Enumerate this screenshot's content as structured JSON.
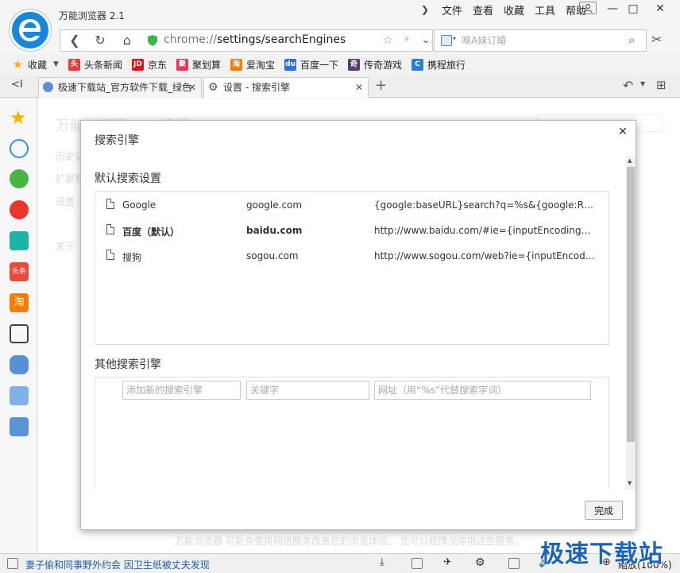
{
  "window": {
    "app_title": "万能浏览器 2.1",
    "menu": [
      "文件",
      "查看",
      "收藏",
      "工具",
      "帮助"
    ]
  },
  "address": {
    "scheme": "chrome://",
    "path": "settings/searchEngines",
    "search_placeholder": "嗅A妹订婚"
  },
  "bookmarks": [
    {
      "label": "收藏",
      "icon": "star-icon",
      "color": "#f5b400"
    },
    {
      "label": "头条新闻",
      "icon": "toutiao-icon",
      "color": "#e63b3b"
    },
    {
      "label": "京东",
      "icon": "jd-icon",
      "color": "#d7141a"
    },
    {
      "label": "聚划算",
      "icon": "juhuasuan-icon",
      "color": "#e6345a"
    },
    {
      "label": "爱淘宝",
      "icon": "aitaobao-icon",
      "color": "#ff7a00"
    },
    {
      "label": "百度一下",
      "icon": "baidu-paw-icon",
      "color": "#2f6fdc"
    },
    {
      "label": "传奇游戏",
      "icon": "game-avatar-icon",
      "color": "#5a3b6e"
    },
    {
      "label": "携程旅行",
      "icon": "ctrip-icon",
      "color": "#2a7fd4"
    }
  ],
  "tabs": [
    {
      "label": "极速下载站_官方软件下载_绿色",
      "icon": "globe-icon"
    },
    {
      "label": "设置 - 搜索引擎",
      "icon": "gear-icon"
    }
  ],
  "background_page": {
    "title": "万能浏览器",
    "subtitle": "设置",
    "nav": [
      "历史记",
      "扩展程",
      "设置",
      "关于"
    ],
    "footer": "万能浏览器 可能会使用网络服务改善您的浏览体验。 您可以视情况停用这些服务。"
  },
  "dialog": {
    "title": "搜索引擎",
    "default_section": "默认搜索设置",
    "default_engines": [
      {
        "name": "Google",
        "keyword": "google.com",
        "url": "{google:baseURL}search?q=%s&{google:RLZ}{goo…",
        "is_default": false
      },
      {
        "name": "百度（默认）",
        "keyword": "baidu.com",
        "url": "http://www.baidu.com/#ie={inputEncoding}&wd=…",
        "is_default": true
      },
      {
        "name": "搜狗",
        "keyword": "sogou.com",
        "url": "http://www.sogou.com/web?ie={inputEncoding}&…",
        "is_default": false
      }
    ],
    "other_section": "其他搜索引擎",
    "add_name_placeholder": "添加新的搜索引擎",
    "add_keyword_placeholder": "关键字",
    "add_url_placeholder": "网址（用“%s”代替搜索字词）",
    "done_label": "完成"
  },
  "status": {
    "news": "妻子偷和同事野外约会 因卫生纸被丈夫发现",
    "zoom": "缩放(100%)"
  },
  "watermark": "极速下载站",
  "colors": {
    "accent": "#1a86d8",
    "link": "#1f5fa8"
  }
}
